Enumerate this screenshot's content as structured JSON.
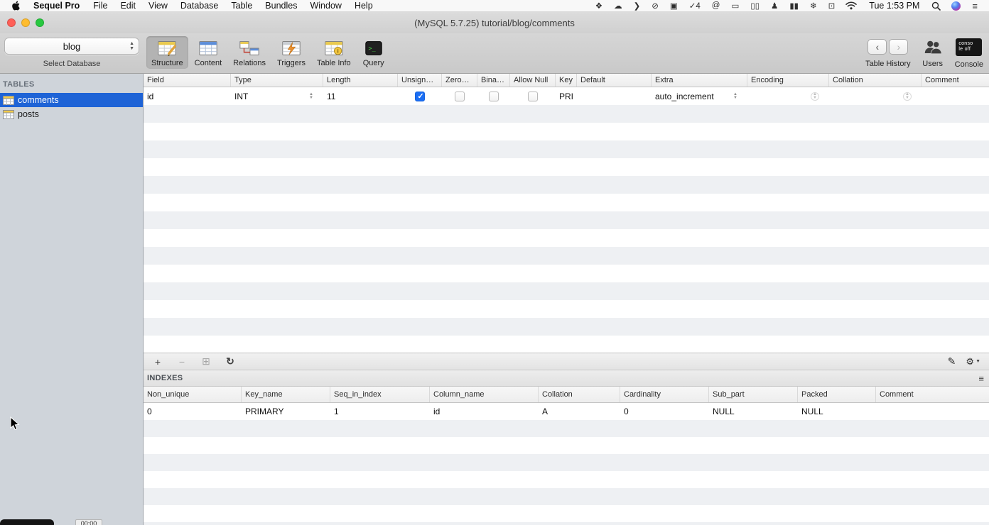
{
  "menu_bar": {
    "app_name": "Sequel Pro",
    "items": [
      "File",
      "Edit",
      "View",
      "Database",
      "Table",
      "Bundles",
      "Window",
      "Help"
    ],
    "status_icons": [
      {
        "name": "dropbox",
        "glyph": "❖"
      },
      {
        "name": "cloud",
        "glyph": "☁"
      },
      {
        "name": "handoff",
        "glyph": "❯"
      },
      {
        "name": "do-not-disturb",
        "glyph": "⊘"
      },
      {
        "name": "screen-recording",
        "glyph": "▣"
      },
      {
        "name": "updates-check",
        "glyph": "✓4"
      },
      {
        "name": "mention",
        "glyph": "@"
      },
      {
        "name": "display",
        "glyph": "▭"
      },
      {
        "name": "mission-control",
        "glyph": "▯▯"
      },
      {
        "name": "user-silhouette",
        "glyph": "♟"
      },
      {
        "name": "stats",
        "glyph": "▮▮"
      },
      {
        "name": "snowflake",
        "glyph": "❄"
      },
      {
        "name": "airplay",
        "glyph": "⊡"
      }
    ],
    "clock": "Tue 1:53 PM",
    "list_glyph": "≡"
  },
  "window": {
    "title": "(MySQL 5.7.25) tutorial/blog/comments"
  },
  "toolbar": {
    "database_select": {
      "value": "blog",
      "label": "Select Database"
    },
    "buttons": [
      {
        "label": "Structure"
      },
      {
        "label": "Content"
      },
      {
        "label": "Relations"
      },
      {
        "label": "Triggers"
      },
      {
        "label": "Table Info"
      },
      {
        "label": "Query"
      }
    ],
    "back_glyph": "‹",
    "forward_glyph": "›",
    "table_history_label": "Table History",
    "users_label": "Users",
    "console_label": "Console",
    "console_icon_line1": "conso",
    "console_icon_line2": "le off"
  },
  "sidebar": {
    "header": "TABLES",
    "items": [
      {
        "label": "comments",
        "selected": true
      },
      {
        "label": "posts",
        "selected": false
      }
    ]
  },
  "structure_table": {
    "columns": [
      "Field",
      "Type",
      "Length",
      "Unsign…",
      "Zero…",
      "Bina…",
      "Allow Null",
      "Key",
      "Default",
      "Extra",
      "Encoding",
      "Collation",
      "Comment"
    ],
    "rows": [
      {
        "field": "id",
        "type": "INT",
        "length": "11",
        "unsigned": true,
        "zerofill": false,
        "binary": false,
        "allow_null": false,
        "key": "PRI",
        "default": "",
        "extra": "auto_increment",
        "encoding": "",
        "collation": "",
        "comment": ""
      }
    ]
  },
  "structure_footer": {
    "add_glyph": "+",
    "remove_glyph": "−",
    "duplicate_glyph": "⊞",
    "refresh_glyph": "↻",
    "edit_glyph": "✎",
    "gear_glyph": "⚙"
  },
  "indexes": {
    "title": "INDEXES",
    "menu_glyph": "≡",
    "columns": [
      "Non_unique",
      "Key_name",
      "Seq_in_index",
      "Column_name",
      "Collation",
      "Cardinality",
      "Sub_part",
      "Packed",
      "Comment"
    ],
    "rows": [
      [
        "0",
        "PRIMARY",
        "1",
        "id",
        "A",
        "0",
        "NULL",
        "NULL",
        ""
      ]
    ]
  },
  "overlay": {
    "timer": "00:00"
  }
}
